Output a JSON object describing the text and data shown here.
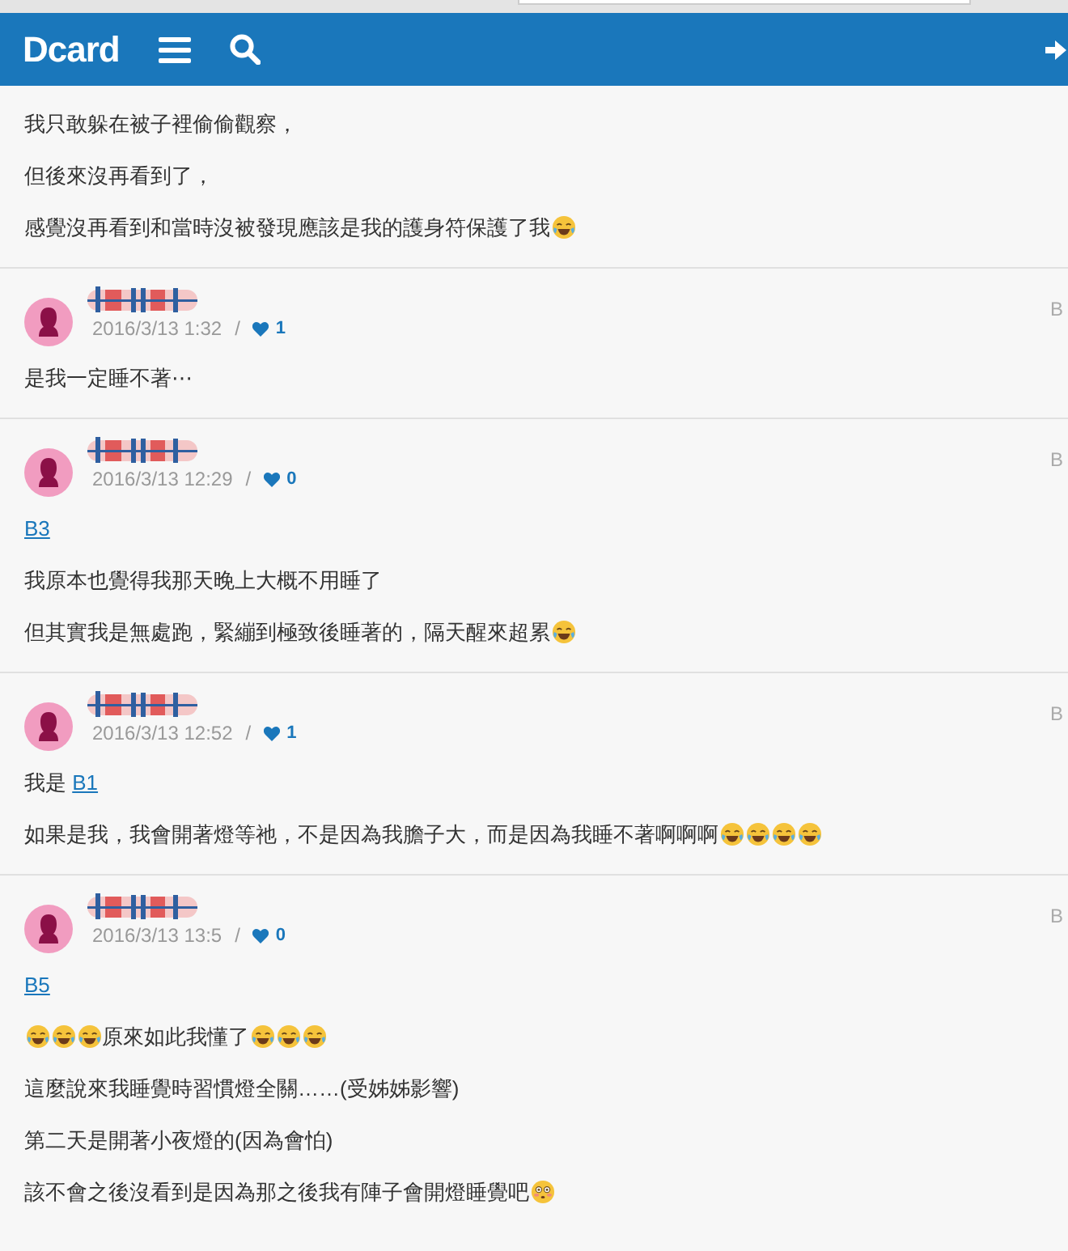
{
  "header": {
    "logo": "Dcard"
  },
  "partial_comment": {
    "paragraphs": [
      {
        "parts": [
          {
            "kind": "text",
            "text": "我只敢躲在被子裡偷偷觀察，"
          }
        ]
      },
      {
        "parts": [
          {
            "kind": "text",
            "text": "但後來沒再看到了，"
          }
        ]
      },
      {
        "parts": [
          {
            "kind": "text",
            "text": "感覺沒再看到和當時沒被發現應該是我的護身符保護了我"
          },
          {
            "kind": "laugh"
          }
        ]
      }
    ]
  },
  "comments": [
    {
      "date": "2016/3/13 1:32",
      "separator": "/",
      "likes": "1",
      "floor": "B",
      "paragraphs": [
        {
          "parts": [
            {
              "kind": "text",
              "text": "是我一定睡不著⋯"
            }
          ]
        }
      ]
    },
    {
      "date": "2016/3/13 12:29",
      "separator": "/",
      "likes": "0",
      "floor": "B",
      "paragraphs": [
        {
          "parts": [
            {
              "kind": "link",
              "text": "B3"
            }
          ]
        },
        {
          "parts": [
            {
              "kind": "text",
              "text": "我原本也覺得我那天晚上大概不用睡了"
            }
          ]
        },
        {
          "parts": [
            {
              "kind": "text",
              "text": "但其實我是無處跑，緊繃到極致後睡著的，隔天醒來超累"
            },
            {
              "kind": "laugh"
            }
          ]
        }
      ]
    },
    {
      "date": "2016/3/13 12:52",
      "separator": "/",
      "likes": "1",
      "floor": "B",
      "paragraphs": [
        {
          "parts": [
            {
              "kind": "text",
              "text": "我是 "
            },
            {
              "kind": "link",
              "text": "B1"
            }
          ]
        },
        {
          "parts": [
            {
              "kind": "text",
              "text": "如果是我，我會開著燈等祂，不是因為我膽子大，而是因為我睡不著啊啊啊"
            },
            {
              "kind": "laugh"
            },
            {
              "kind": "laugh"
            },
            {
              "kind": "laugh"
            },
            {
              "kind": "laugh"
            }
          ]
        }
      ]
    },
    {
      "date": "2016/3/13 13:5",
      "separator": "/",
      "likes": "0",
      "floor": "B",
      "paragraphs": [
        {
          "parts": [
            {
              "kind": "link",
              "text": "B5"
            }
          ]
        },
        {
          "parts": [
            {
              "kind": "laugh"
            },
            {
              "kind": "laugh"
            },
            {
              "kind": "laugh"
            },
            {
              "kind": "text",
              "text": "原來如此我懂了"
            },
            {
              "kind": "laugh"
            },
            {
              "kind": "laugh"
            },
            {
              "kind": "laugh"
            }
          ]
        },
        {
          "parts": [
            {
              "kind": "text",
              "text": "這麼說來我睡覺時習慣燈全關……(受姊姊影響)"
            }
          ]
        },
        {
          "parts": [
            {
              "kind": "text",
              "text": "第二天是開著小夜燈的(因為會怕)"
            }
          ]
        },
        {
          "parts": [
            {
              "kind": "text",
              "text": "該不會之後沒看到是因為那之後我有陣子會開燈睡覺吧"
            },
            {
              "kind": "flushed"
            }
          ]
        }
      ]
    }
  ]
}
